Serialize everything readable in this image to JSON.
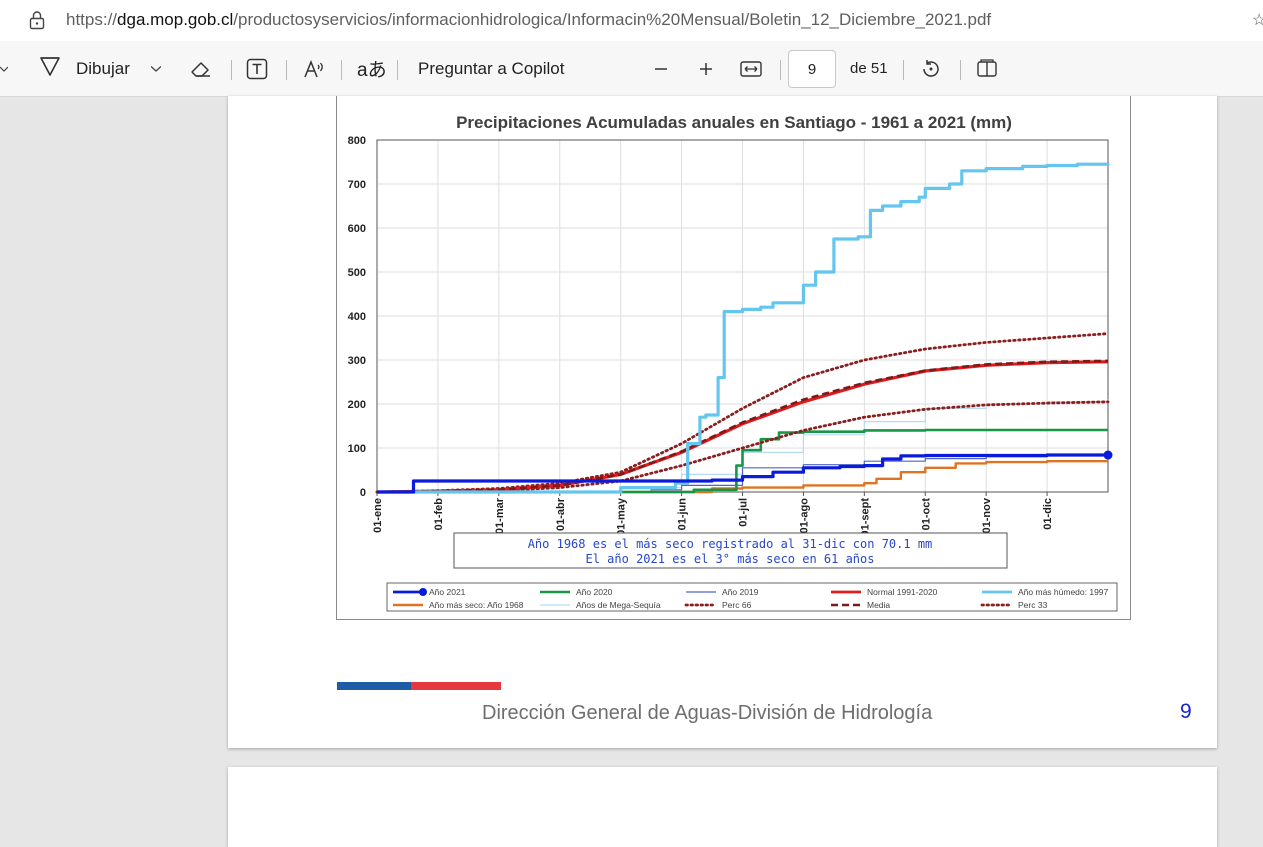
{
  "browser": {
    "url_prefix": "https://",
    "url_domain": "dga.mop.gob.cl",
    "url_path": "/productosyservicios/informacionhidrologica/Informacin%20Mensual/Boletin_12_Diciembre_2021.pdf"
  },
  "toolbar": {
    "draw_label": "Dibujar",
    "copilot_label": "Preguntar a Copilot",
    "page_current": "9",
    "page_total": "de 51"
  },
  "pdf": {
    "footer_text": "Dirección General de Aguas-División de Hidrología",
    "page_number": "9"
  },
  "chart_data": {
    "type": "line",
    "title": "Precipitaciones Acumuladas anuales en Santiago - 1961 a 2021 (mm)",
    "ylim": [
      0,
      800
    ],
    "yticks": [
      "0",
      "100",
      "200",
      "300",
      "400",
      "500",
      "600",
      "700",
      "800"
    ],
    "xticks": [
      "01-ene",
      "01-feb",
      "01-mar",
      "01-abr",
      "01-may",
      "01-jun",
      "01-jul",
      "01-ago",
      "01-sept",
      "01-oct",
      "01-nov",
      "01-dic"
    ],
    "annotation_lines": [
      "Año 1968 es el más seco registrado al 31-dic con 70.1 mm",
      "El año 2021 es el 3° más seco en 61 años"
    ],
    "series": [
      {
        "name": "Año 2021",
        "color": "#0a1bdc",
        "style": "solid-marker",
        "x": [
          0,
          0.5,
          0.6,
          5.0,
          5.5,
          6.0,
          6.5,
          7.0,
          7.6,
          8.0,
          8.3,
          8.6,
          9.0,
          10.0,
          11.0,
          12.0
        ],
        "values": [
          0,
          0,
          25,
          25,
          27,
          35,
          45,
          55,
          58,
          60,
          75,
          82,
          83,
          83,
          84,
          84
        ]
      },
      {
        "name": "Año 2020",
        "color": "#179645",
        "style": "solid",
        "x": [
          0,
          4.9,
          5.2,
          5.5,
          5.9,
          6.0,
          6.3,
          6.6,
          7.0,
          8.0,
          9.0,
          10.0,
          11.0,
          12.0
        ],
        "values": [
          0,
          0,
          5,
          5,
          60,
          95,
          120,
          135,
          137,
          140,
          141,
          141,
          141,
          141
        ]
      },
      {
        "name": "Año 2019",
        "color": "#4f66c9",
        "style": "thin",
        "x": [
          0,
          4.5,
          5.0,
          6.0,
          7.0,
          8.0,
          9.0,
          10.0,
          11.0,
          12.0
        ],
        "values": [
          0,
          5,
          15,
          55,
          62,
          70,
          76,
          80,
          82,
          82
        ]
      },
      {
        "name": "Normal 1991-2020",
        "color": "#e11b1b",
        "style": "solid",
        "x": [
          0,
          1,
          2,
          3,
          4,
          5,
          6,
          7,
          8,
          9,
          10,
          11,
          12
        ],
        "values": [
          0,
          2,
          5,
          15,
          40,
          90,
          155,
          205,
          245,
          275,
          288,
          294,
          296
        ]
      },
      {
        "name": "Año más húmedo: 1997",
        "color": "#64c6ef",
        "style": "solid",
        "x": [
          0,
          4.0,
          4.9,
          5.1,
          5.3,
          5.4,
          5.6,
          5.7,
          6.0,
          6.3,
          6.5,
          7.0,
          7.2,
          7.5,
          7.9,
          8.1,
          8.3,
          8.6,
          8.9,
          9.0,
          9.4,
          9.6,
          10.0,
          10.6,
          11.0,
          11.5,
          12.0
        ],
        "values": [
          0,
          10,
          20,
          110,
          170,
          175,
          260,
          410,
          415,
          420,
          430,
          470,
          500,
          575,
          580,
          640,
          650,
          660,
          670,
          690,
          700,
          730,
          735,
          740,
          742,
          745,
          746
        ]
      },
      {
        "name": "Año más seco: Año 1968",
        "color": "#e07323",
        "style": "solid",
        "x": [
          0,
          5.2,
          5.5,
          6.0,
          7.0,
          8.0,
          8.2,
          8.6,
          9.0,
          9.5,
          10.0,
          11.0,
          12.0
        ],
        "values": [
          0,
          0,
          8,
          10,
          15,
          20,
          30,
          45,
          55,
          65,
          68,
          70,
          70.1
        ]
      },
      {
        "name": "Años de Mega-Sequía",
        "color": "#b6dbf2",
        "style": "thin",
        "x": [
          0,
          4.0,
          5.0,
          6.0,
          7.0,
          8.0,
          9.0,
          10.0,
          11.0,
          12.0
        ],
        "values": [
          0,
          10,
          40,
          90,
          130,
          160,
          190,
          200,
          205,
          210
        ]
      },
      {
        "name": "Perc 66",
        "color": "#8b1e1e",
        "style": "dotted",
        "x": [
          0,
          1,
          2,
          3,
          4,
          5,
          6,
          7,
          7.5,
          8,
          9,
          10,
          11,
          12
        ],
        "values": [
          0,
          3,
          8,
          20,
          45,
          110,
          190,
          260,
          280,
          300,
          325,
          340,
          350,
          360
        ]
      },
      {
        "name": "Media",
        "color": "#7a1a1a",
        "style": "dashed",
        "x": [
          0,
          1,
          2,
          3,
          4,
          5,
          6,
          7,
          8,
          9,
          10,
          11,
          12
        ],
        "values": [
          0,
          2,
          5,
          15,
          40,
          92,
          158,
          210,
          248,
          276,
          290,
          296,
          298
        ]
      },
      {
        "name": "Perc 33",
        "color": "#8b1e1e",
        "style": "dotted",
        "x": [
          0,
          1,
          2,
          3,
          4,
          5,
          6,
          7,
          8,
          9,
          10,
          11,
          12
        ],
        "values": [
          0,
          1,
          3,
          10,
          25,
          60,
          100,
          140,
          170,
          188,
          198,
          202,
          205
        ]
      }
    ],
    "legend_position": "bottom"
  }
}
